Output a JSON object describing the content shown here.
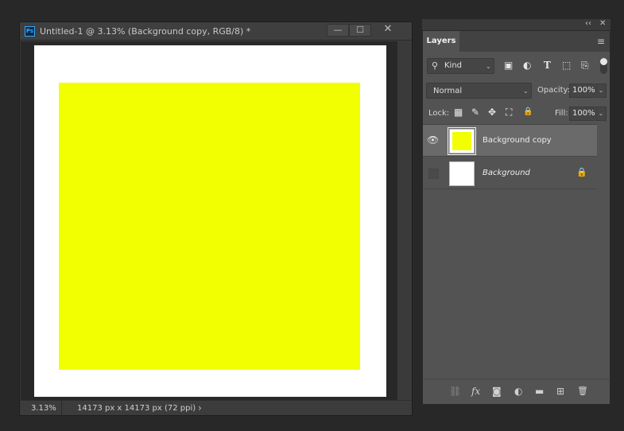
{
  "document": {
    "title": "Untitled-1 @ 3.13% (Background copy, RGB/8) *",
    "app_logo": "Ps",
    "window_buttons": {
      "minimize": "—",
      "maximize": "☐",
      "close": "✕"
    },
    "canvas_background": "#ffffff",
    "layer_fill_color": "#f2ff00",
    "status": {
      "zoom": "3.13%",
      "dimensions": "14173 px x 14173 px (72 ppi)",
      "arrow": "›"
    }
  },
  "panel_header": {
    "collapse": "‹‹",
    "close": "✕"
  },
  "layers_panel": {
    "tab_label": "Layers",
    "menu_icon": "≡",
    "filter": {
      "kind_label": "Kind",
      "icons": [
        "image-filter-icon",
        "adjustment-filter-icon",
        "type-filter-icon",
        "shape-filter-icon",
        "smart-object-filter-icon"
      ],
      "glyphs": {
        "search": "⚲",
        "image": "▣",
        "adjustment": "◐",
        "type": "T",
        "shape": "⬚",
        "smart": "⎘"
      }
    },
    "blend_mode": "Normal",
    "opacity_label": "Opacity:",
    "opacity_value": "100%",
    "lock_label": "Lock:",
    "lock_glyphs": {
      "pixels": "▦",
      "paint": "✎",
      "move": "✥",
      "artboard": "⛶",
      "all": "🔒"
    },
    "fill_label": "Fill:",
    "fill_value": "100%",
    "layers": [
      {
        "name": "Background copy",
        "visible": true,
        "selected": true,
        "thumb_color": "#f2ff00",
        "locked": false
      },
      {
        "name": "Background",
        "visible": false,
        "selected": false,
        "thumb_color": "#ffffff",
        "locked": true
      }
    ],
    "lock_glyph": "🔒",
    "eye_glyph": "👁",
    "footer": {
      "link": "⛓",
      "fx": "fx",
      "mask": "◙",
      "adjustment": "◐",
      "folder": "▬",
      "new": "⊞",
      "delete": "🗑"
    }
  }
}
